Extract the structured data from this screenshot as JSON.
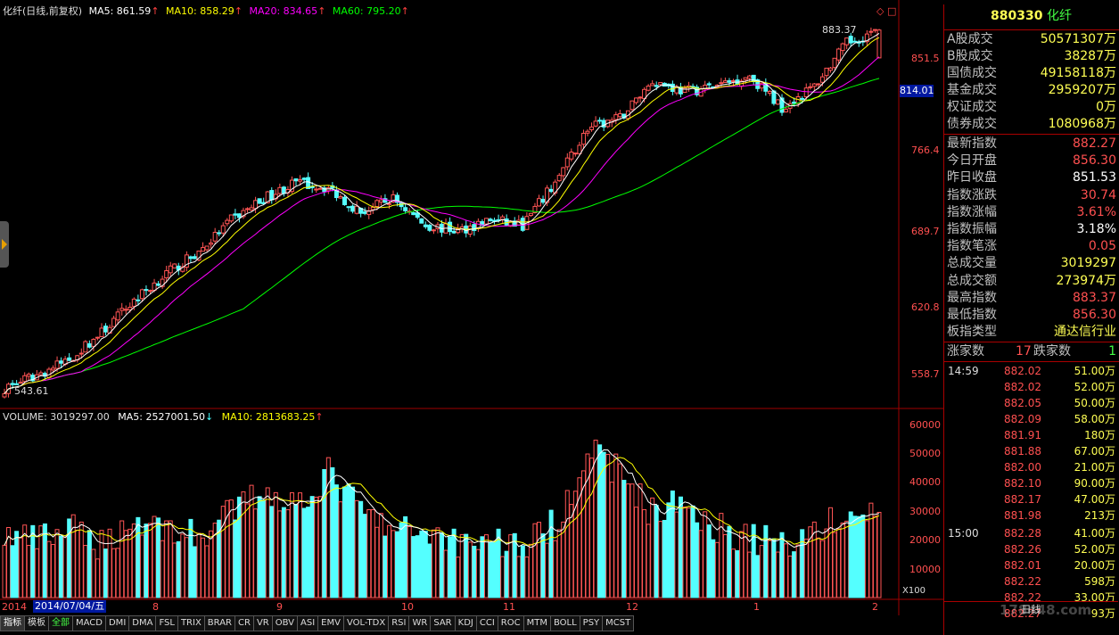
{
  "main_header": {
    "title": "化纤(日线,前复权)",
    "ma5": "MA5: 861.59",
    "ma10": "MA10: 858.29",
    "ma20": "MA20: 834.65",
    "ma60": "MA60: 795.20"
  },
  "volume_header": {
    "volume": "VOLUME: 3019297.00",
    "ma5": "MA5: 2527001.50",
    "ma10": "MA10: 2813683.25"
  },
  "price_axis": {
    "ticks": [
      "851.5",
      "766.4",
      "689.7",
      "620.8",
      "558.7"
    ],
    "current_marker": "814.01",
    "high_label": "883.37",
    "low_label": "543.61"
  },
  "volume_axis": {
    "ticks": [
      "60000",
      "50000",
      "40000",
      "30000",
      "20000",
      "10000"
    ],
    "unit": "X100"
  },
  "date_axis": {
    "start_label": "2014",
    "selected_date": "2014/07/04/五",
    "months": [
      "8",
      "9",
      "10",
      "11",
      "12",
      "1",
      "2"
    ]
  },
  "panel": {
    "code": "880330",
    "name": "化纤",
    "turnover_rows": [
      {
        "k": "A股成交",
        "v": "50571307万"
      },
      {
        "k": "B股成交",
        "v": "38287万"
      },
      {
        "k": "国债成交",
        "v": "49158118万"
      },
      {
        "k": "基金成交",
        "v": "2959207万"
      },
      {
        "k": "权证成交",
        "v": "0万"
      },
      {
        "k": "债券成交",
        "v": "1080968万"
      }
    ],
    "index_rows": [
      {
        "k": "最新指数",
        "v": "882.27"
      },
      {
        "k": "今日开盘",
        "v": "856.30"
      },
      {
        "k": "昨日收盘",
        "v": "851.53"
      },
      {
        "k": "指数涨跌",
        "v": "30.74"
      },
      {
        "k": "指数涨幅",
        "v": "3.61%"
      },
      {
        "k": "指数振幅",
        "v": "3.18%"
      },
      {
        "k": "指数笔涨",
        "v": "0.05"
      },
      {
        "k": "总成交量",
        "v": "3019297"
      },
      {
        "k": "总成交额",
        "v": "273974万"
      },
      {
        "k": "最高指数",
        "v": "883.37"
      },
      {
        "k": "最低指数",
        "v": "856.30"
      },
      {
        "k": "板指类型",
        "v": "通达信行业"
      }
    ],
    "rise_label": "涨家数",
    "rise_count": "17",
    "fall_label": "跌家数",
    "fall_count": "1",
    "ticks": [
      {
        "t": "14:59",
        "p": "882.02",
        "q": "51.00万"
      },
      {
        "t": "",
        "p": "882.02",
        "q": "52.00万"
      },
      {
        "t": "",
        "p": "882.05",
        "q": "50.00万"
      },
      {
        "t": "",
        "p": "882.09",
        "q": "58.00万"
      },
      {
        "t": "",
        "p": "881.91",
        "q": "180万"
      },
      {
        "t": "",
        "p": "881.88",
        "q": "67.00万"
      },
      {
        "t": "",
        "p": "882.00",
        "q": "21.00万"
      },
      {
        "t": "",
        "p": "882.10",
        "q": "90.00万"
      },
      {
        "t": "",
        "p": "882.17",
        "q": "47.00万"
      },
      {
        "t": "",
        "p": "881.98",
        "q": "213万"
      },
      {
        "t": "15:00",
        "p": "882.28",
        "q": "41.00万"
      },
      {
        "t": "",
        "p": "882.26",
        "q": "52.00万"
      },
      {
        "t": "",
        "p": "882.01",
        "q": "20.00万"
      },
      {
        "t": "",
        "p": "882.22",
        "q": "598万"
      },
      {
        "t": "",
        "p": "882.22",
        "q": "33.00万"
      },
      {
        "t": "",
        "p": "882.27",
        "q": "93万"
      }
    ],
    "period": "日线",
    "watermark": "178448.com"
  },
  "tabs": [
    "指标",
    "模板",
    "全部",
    "MACD",
    "DMI",
    "DMA",
    "FSL",
    "TRIX",
    "BRAR",
    "CR",
    "VR",
    "OBV",
    "ASI",
    "EMV",
    "VOL-TDX",
    "RSI",
    "WR",
    "SAR",
    "KDJ",
    "CCI",
    "ROC",
    "MTM",
    "BOLL",
    "PSY",
    "MCST"
  ],
  "colors": {
    "up": "#ff5454",
    "down": "#54ffff",
    "ma5": "#ffffff",
    "ma10": "#ffff00",
    "ma20": "#ff00ff",
    "ma60": "#00ff00",
    "grid": "#a00000"
  },
  "chart_data": {
    "type": "candlestick",
    "price_range": [
      543.61,
      883.37
    ],
    "series": [
      {
        "name": "MA5",
        "values": [
          861.59
        ]
      },
      {
        "name": "MA10",
        "values": [
          858.29
        ]
      },
      {
        "name": "MA20",
        "values": [
          834.65
        ]
      },
      {
        "name": "MA60",
        "values": [
          795.2
        ]
      }
    ],
    "price_path": [
      [
        0,
        548
      ],
      [
        8,
        560
      ],
      [
        16,
        575
      ],
      [
        24,
        600
      ],
      [
        32,
        630
      ],
      [
        40,
        655
      ],
      [
        48,
        675
      ],
      [
        56,
        705
      ],
      [
        64,
        725
      ],
      [
        72,
        740
      ],
      [
        80,
        735
      ],
      [
        88,
        712
      ],
      [
        96,
        725
      ],
      [
        104,
        700
      ],
      [
        112,
        695
      ],
      [
        120,
        705
      ],
      [
        128,
        700
      ],
      [
        136,
        740
      ],
      [
        144,
        790
      ],
      [
        152,
        800
      ],
      [
        160,
        835
      ],
      [
        168,
        825
      ],
      [
        176,
        830
      ],
      [
        184,
        840
      ],
      [
        192,
        810
      ],
      [
        200,
        830
      ],
      [
        208,
        870
      ],
      [
        216,
        882.27
      ]
    ],
    "volume_path": [
      [
        0,
        22000
      ],
      [
        8,
        20000
      ],
      [
        16,
        24000
      ],
      [
        24,
        19000
      ],
      [
        32,
        27000
      ],
      [
        40,
        25000
      ],
      [
        48,
        21000
      ],
      [
        56,
        30000
      ],
      [
        64,
        38000
      ],
      [
        72,
        33000
      ],
      [
        80,
        44000
      ],
      [
        88,
        31000
      ],
      [
        96,
        23000
      ],
      [
        104,
        24000
      ],
      [
        112,
        20000
      ],
      [
        120,
        21000
      ],
      [
        128,
        18000
      ],
      [
        136,
        26000
      ],
      [
        144,
        52000
      ],
      [
        152,
        45000
      ],
      [
        160,
        30000
      ],
      [
        168,
        34000
      ],
      [
        176,
        25000
      ],
      [
        184,
        21000
      ],
      [
        192,
        19000
      ],
      [
        200,
        24000
      ],
      [
        208,
        28000
      ],
      [
        216,
        30193
      ]
    ],
    "volume_range": [
      0,
      60000
    ]
  }
}
